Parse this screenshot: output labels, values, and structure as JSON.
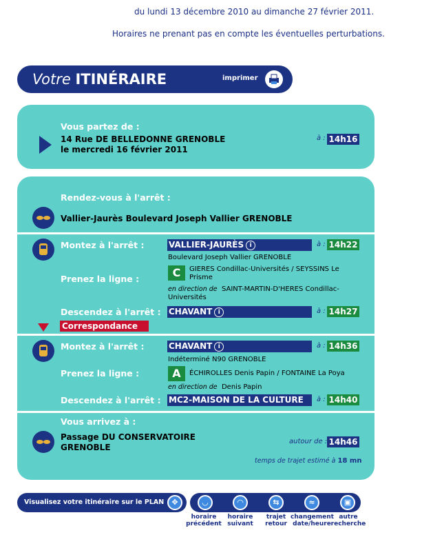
{
  "period": "du lundi 13 décembre 2010 au dimanche 27 février 2011.",
  "disclaimer": "Horaires ne prenant pas en compte les éventuelles perturbations.",
  "header": {
    "title_italic": "Votre",
    "title_bold": "ITINÉRAIRE",
    "print_label": "imprimer"
  },
  "departure": {
    "label": "Vous partez de :",
    "address": "14 Rue DE BELLEDONNE GRENOBLE",
    "date": "le mercredi 16 février 2011",
    "at": "à :",
    "time": "14h16"
  },
  "meet": {
    "label": "Rendez-vous à l'arrêt :",
    "stop": "Vallier-Jaurès Boulevard Joseph Vallier GRENOBLE"
  },
  "leg1": {
    "board_label": "Montez à l'arrêt :",
    "board_stop": "VALLIER-JAURÈS",
    "board_sub": "Boulevard Joseph Vallier GRENOBLE",
    "board_time": "14h22",
    "line_label": "Prenez la ligne :",
    "line_code": "C",
    "line_name": "GIERES Condillac-Universités / SEYSSINS Le Prisme",
    "direction_prefix": "en direction de",
    "direction": "SAINT-MARTIN-D'HERES Condillac-Universités",
    "alight_label": "Descendez à l'arrêt :",
    "alight_stop": "CHAVANT",
    "alight_time": "14h27",
    "at": "à :"
  },
  "transfer_label": "Correspondance",
  "leg2": {
    "board_label": "Montez à l'arrêt :",
    "board_stop": "CHAVANT",
    "board_sub": "Indéterminé N90 GRENOBLE",
    "board_time": "14h36",
    "line_label": "Prenez la ligne :",
    "line_code": "A",
    "line_name": "ÉCHIROLLES Denis Papin / FONTAINE La Poya",
    "direction_prefix": "en direction de",
    "direction": "Denis Papin",
    "alight_label": "Descendez à l'arrêt :",
    "alight_stop": "MC2-MAISON DE LA CULTURE",
    "alight_time": "14h40",
    "at": "à :"
  },
  "arrival": {
    "label": "Vous arrivez à :",
    "place": "Passage DU CONSERVATOIRE GRENOBLE",
    "around": "autour de :",
    "time": "14h46",
    "duration_prefix": "temps de trajet estimé à",
    "duration": "18 mn"
  },
  "footer": {
    "map_button": "Visualisez votre itinéraire sur le PLAN",
    "nav": [
      {
        "l1": "horaire",
        "l2": "précédent"
      },
      {
        "l1": "horaire",
        "l2": "suivant"
      },
      {
        "l1": "trajet",
        "l2": "retour"
      },
      {
        "l1": "changement",
        "l2": "date/heure"
      },
      {
        "l1": "autre",
        "l2": "recherche"
      }
    ]
  },
  "colors": {
    "navy": "#1c3282",
    "teal": "#5fcfc9",
    "green": "#1a8b3f",
    "red": "#c8102e"
  }
}
